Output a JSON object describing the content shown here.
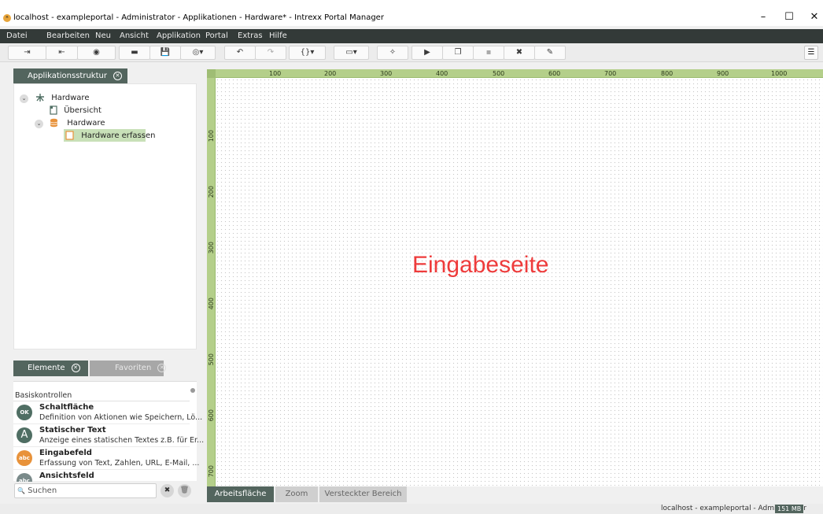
{
  "window": {
    "app_icon": "ⁿ",
    "title": "localhost - exampleportal - Administrator - Applikationen - Hardware* - Intrexx Portal Manager",
    "minimize": "–",
    "maximize": "☐",
    "close": "✕"
  },
  "menu": [
    "Datei",
    "Bearbeiten",
    "Neu",
    "Ansicht",
    "Applikation",
    "Portal",
    "Extras",
    "Hilfe"
  ],
  "toolbar": {
    "icons": [
      "import-icon",
      "export-icon",
      "globe-icon",
      "folder-icon",
      "save-icon",
      "language-icon",
      "undo-icon",
      "redo-icon",
      "variables-icon",
      "preview-icon",
      "wand-icon",
      "run-icon",
      "copy-icon",
      "paste-icon",
      "delete-icon",
      "edit-icon"
    ],
    "glyphs": [
      "⇥",
      "⇤",
      "◉",
      "▬",
      "💾",
      "◎▾",
      "↶",
      "↷",
      "{}▾",
      "▭▾",
      "✧",
      "▶",
      "❐",
      "▪",
      "✖",
      "✎"
    ],
    "menu_glyph": "☰"
  },
  "left_panel": {
    "tab_title": "Applikationsstruktur",
    "tab_close": "✕",
    "tree": [
      {
        "label": "Hardware",
        "icon": "application-icon",
        "expanded": true
      },
      {
        "label": "Übersicht",
        "icon": "page-icon"
      },
      {
        "label": "Hardware",
        "icon": "datagroup-icon",
        "expanded": true
      },
      {
        "label": "Hardware erfassen",
        "icon": "input-page-icon",
        "selected": true
      }
    ]
  },
  "elements_panel": {
    "tabs": [
      {
        "label": "Elemente",
        "active": true
      },
      {
        "label": "Favoriten",
        "active": false
      }
    ],
    "tab_close": "✕",
    "section": "Basiskontrollen",
    "items": [
      {
        "title": "Schaltfläche",
        "desc": "Definition von Aktionen wie Speichern, Lö...",
        "icon_text": "OK",
        "color": "#4f6e63"
      },
      {
        "title": "Statischer Text",
        "desc": "Anzeige eines statischen Textes z.B. für Er...",
        "icon_text": "A",
        "color": "#4f6e63"
      },
      {
        "title": "Eingabefeld",
        "desc": "Erfassung von Text, Zahlen, URL, E-Mail, ...",
        "icon_text": "abc",
        "color": "#e8923a"
      },
      {
        "title": "Ansichtsfeld",
        "desc": "",
        "icon_text": "abc",
        "color": "#7a8a8a"
      }
    ],
    "search_placeholder": "Suchen",
    "search_icon": "🔍",
    "clear_glyph": "✖",
    "trash_glyph": "🗑"
  },
  "canvas": {
    "ruler_top": [
      "100",
      "200",
      "300",
      "400",
      "500",
      "600",
      "700",
      "800",
      "900",
      "1000"
    ],
    "ruler_left": [
      "100",
      "200",
      "300",
      "400",
      "500",
      "600",
      "700"
    ],
    "label": "Eingabeseite",
    "label_color": "#ee3b3b"
  },
  "bottom_tabs": [
    {
      "label": "Arbeitsfläche",
      "active": true
    },
    {
      "label": "Zoom",
      "active": false
    },
    {
      "label": "Versteckter Bereich",
      "active": false
    }
  ],
  "status": {
    "text": "localhost - exampleportal - Administrator",
    "badge": "151 MB"
  }
}
